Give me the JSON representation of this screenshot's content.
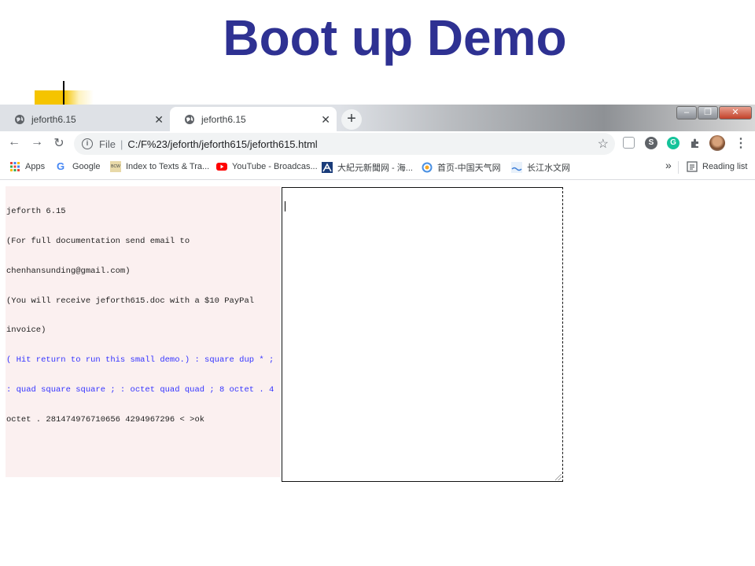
{
  "slide": {
    "title": "Boot up Demo"
  },
  "browser": {
    "tabs": [
      {
        "label": "jeforth6.15",
        "active": false
      },
      {
        "label": "jeforth6.15",
        "active": true
      }
    ],
    "address": {
      "prefix": "File",
      "url": "C:/F%23/jeforth/jeforth615/jeforth615.html"
    },
    "bookmarks": {
      "items": [
        {
          "label": "Apps",
          "icon": "apps-grid-icon"
        },
        {
          "label": "Google",
          "icon": "google-icon"
        },
        {
          "label": "Index to Texts & Tra...",
          "icon": "bcw-icon"
        },
        {
          "label": "YouTube - Broadcas...",
          "icon": "youtube-icon"
        },
        {
          "label": "大紀元新聞网 - 海...",
          "icon": "epochtimes-icon"
        },
        {
          "label": "首页-中国天气网",
          "icon": "weather-icon"
        },
        {
          "label": "长江水文网",
          "icon": "hydrology-icon"
        }
      ],
      "overflow": "»",
      "reading_list": "Reading list"
    }
  },
  "console": {
    "lines": [
      "jeforth 6.15",
      "(For full documentation send email to",
      "chenhansunding@gmail.com)",
      "(You will receive jeforth615.doc with a $10 PayPal",
      "invoice)"
    ],
    "demo_lines": [
      "( Hit return to run this small demo.) : square dup * ;",
      ": quad square square ; : octet quad quad ; 8 octet . 4"
    ],
    "result_lines": [
      "octet . 281474976710656 4294967296 < >ok"
    ]
  },
  "colors": {
    "title": "#2e3192",
    "console_bg": "#fbf0f0",
    "demo_text": "#3333ff"
  }
}
